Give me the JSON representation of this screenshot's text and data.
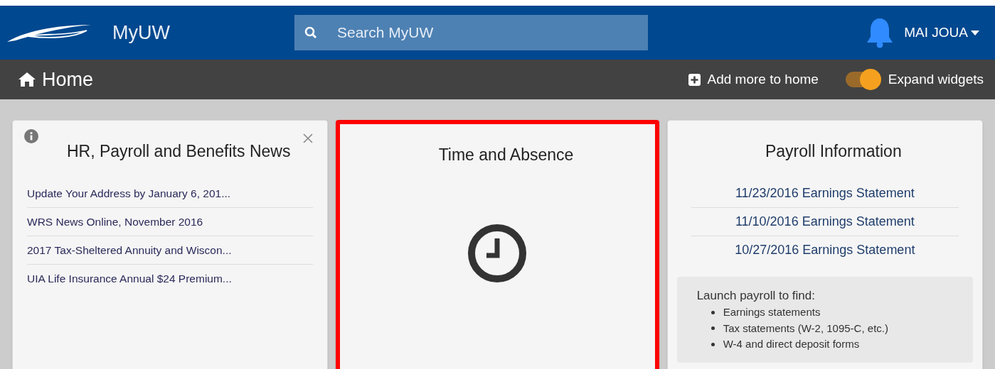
{
  "header": {
    "app_name": "MyUW",
    "search": {
      "placeholder": "Search MyUW"
    },
    "user_name": "MAI JOUA"
  },
  "toolbar": {
    "title": "Home",
    "add_button": "Add more to home",
    "expand_toggle": {
      "label": "Expand widgets",
      "on": true
    }
  },
  "widgets": [
    {
      "kind": "list",
      "title": "HR, Payroll and Benefits News",
      "highlighted": false,
      "items": [
        "Update Your Address by January 6, 201...",
        "WRS News Online, November 2016",
        "2017 Tax-Sheltered Annuity and Wiscon...",
        "UIA Life Insurance Annual $24 Premium..."
      ]
    },
    {
      "kind": "launch",
      "title": "Time and Absence",
      "highlighted": true
    },
    {
      "kind": "links",
      "title": "Payroll Information",
      "highlighted": false,
      "items": [
        "11/23/2016 Earnings Statement",
        "11/10/2016 Earnings Statement",
        "10/27/2016 Earnings Statement"
      ],
      "note": {
        "heading": "Launch payroll to find:",
        "bullets": [
          "Earnings statements",
          "Tax statements (W-2, 1095-C, etc.)",
          "W-4 and direct deposit forms"
        ]
      }
    }
  ]
}
